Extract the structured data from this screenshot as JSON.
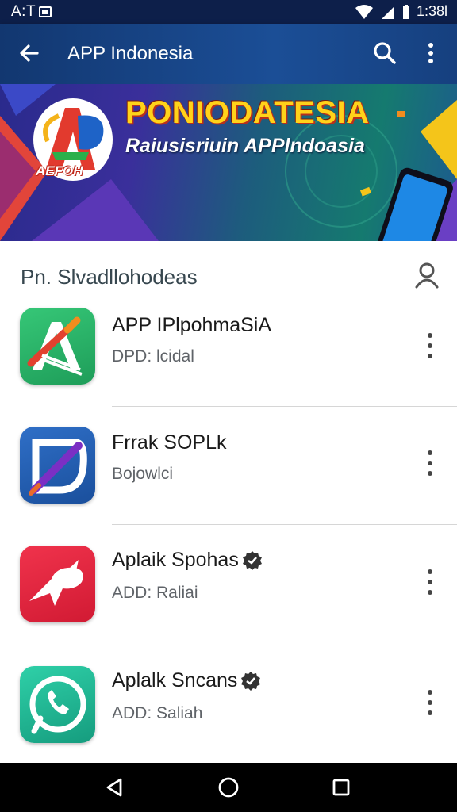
{
  "status_bar": {
    "time_left": "A:T",
    "time_right": "1:38l",
    "icons": [
      "wifi-icon",
      "signal-icon",
      "battery-icon"
    ]
  },
  "app_bar": {
    "title": "APP Indonesia",
    "icons": [
      "back-arrow-icon",
      "search-icon",
      "more-vert-icon"
    ]
  },
  "banner": {
    "headline": "PONIODATESIA",
    "subtitle": "Raiusisriuin APPlndoasia",
    "logo_text": "AEFOH"
  },
  "section": {
    "title": "Pn. Slvadllohodeas",
    "icon": "user-icon"
  },
  "apps": [
    {
      "name": "APP IPlpohmaSiA",
      "subtitle": "DPD: lcidal",
      "verified": false,
      "icon": "pen-ruler-app-icon",
      "color": "#27b36a"
    },
    {
      "name": "Frrak SOPLk",
      "subtitle": "Bojowlci",
      "verified": false,
      "icon": "brush-app-icon",
      "color": "#1c5fb0"
    },
    {
      "name": "Aplaik Spohas",
      "subtitle": "ADD: Raliai",
      "verified": true,
      "icon": "bird-app-icon",
      "color": "#e8243c"
    },
    {
      "name": "Aplalk Sncans",
      "subtitle": "ADD: Saliah",
      "verified": true,
      "icon": "phone-app-icon",
      "color": "#1fb58f"
    }
  ],
  "nav_bar": {
    "icons": [
      "back-triangle-icon",
      "home-circle-icon",
      "recents-square-icon"
    ]
  },
  "colors": {
    "app_bar": "#1b4e96",
    "status_bar": "#0d1f4a",
    "banner_headline": "#ffd21a"
  }
}
